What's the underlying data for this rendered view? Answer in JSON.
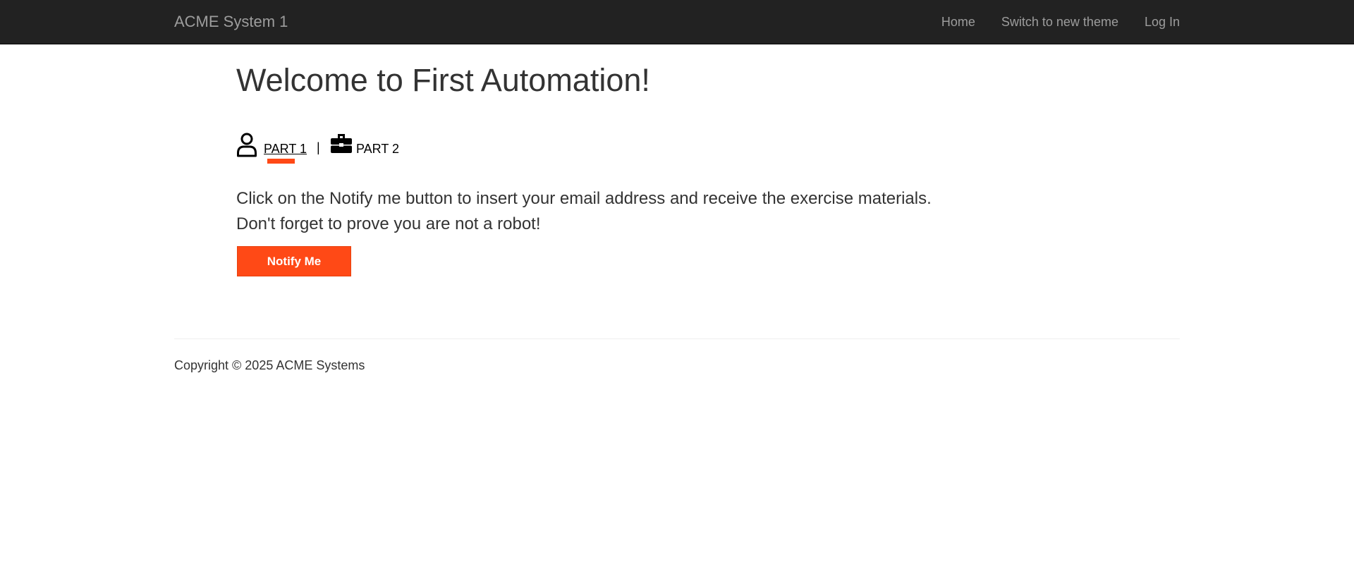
{
  "navbar": {
    "brand": "ACME System 1",
    "links": [
      {
        "label": "Home"
      },
      {
        "label": "Switch to new theme"
      },
      {
        "label": "Log In"
      }
    ]
  },
  "main": {
    "title": "Welcome to First Automation!",
    "tabs": [
      {
        "label": "PART 1",
        "icon": "user-icon",
        "active": true
      },
      {
        "label": "PART 2",
        "icon": "briefcase-icon",
        "active": false
      }
    ],
    "tab_separator": "|",
    "instructions": [
      "Click on the Notify me button to insert your email address and receive the exercise materials.",
      "Don't forget to prove you are not a robot!"
    ],
    "notify_button": "Notify Me"
  },
  "footer": {
    "copyright": "Copyright © 2025 ACME Systems"
  },
  "colors": {
    "navbar_bg": "#222222",
    "nav_text": "#9d9d9d",
    "accent": "#ff4916",
    "text": "#333333"
  }
}
